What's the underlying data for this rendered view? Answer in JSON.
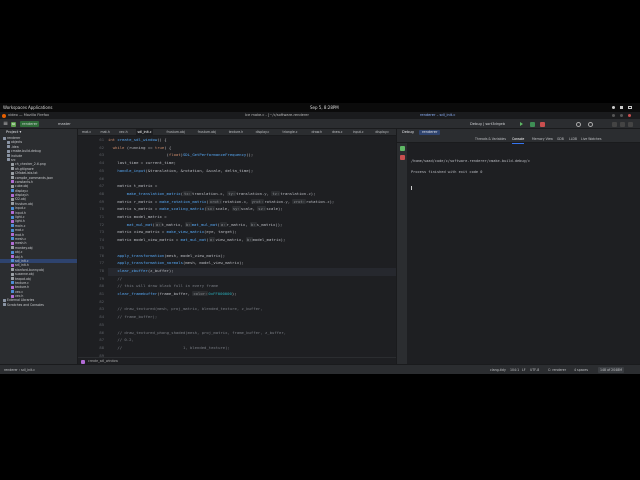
{
  "desktop": {
    "activities": "Workspaces",
    "applications": "Applications",
    "clock": "Sep 5, 8:28PM"
  },
  "window": {
    "title_left": "video — Mozilla Firefox",
    "title_center": "Ice make.c - [~/c/software-renderer",
    "title_right": "renderer – sdl_init.c"
  },
  "toolbar": {
    "project_badge": "SR",
    "project_name": "renderer",
    "branch": "master",
    "run_config": "Debug | sort3drgeb"
  },
  "project_panel": {
    "header": "Project",
    "tree": [
      {
        "label": "renderer",
        "depth": 0,
        "kind": "folder"
      },
      {
        "label": "objects",
        "depth": 1,
        "kind": "folder"
      },
      {
        "label": ".idea",
        "depth": 1,
        "kind": "folder"
      },
      {
        "label": "cmake-build-debug",
        "depth": 1,
        "kind": "folder"
      },
      {
        "label": "include",
        "depth": 1,
        "kind": "folder"
      },
      {
        "label": "src",
        "depth": 1,
        "kind": "folder"
      },
      {
        "label": "ch_checker_2.tl.png",
        "depth": 2,
        "kind": "file"
      },
      {
        "label": "ah.gitignore",
        "depth": 2,
        "kind": "file"
      },
      {
        "label": "CMakeLists.txt",
        "depth": 2,
        "kind": "file"
      },
      {
        "label": "compile_commands.json",
        "depth": 2,
        "kind": "file"
      },
      {
        "label": "constants.h",
        "depth": 2,
        "kind": "file"
      },
      {
        "label": "cube.obj",
        "depth": 2,
        "kind": "file"
      },
      {
        "label": "display.c",
        "depth": 2,
        "kind": "file"
      },
      {
        "label": "display.h",
        "depth": 2,
        "kind": "file"
      },
      {
        "label": "f22.obj",
        "depth": 2,
        "kind": "file"
      },
      {
        "label": "frustum.obj",
        "depth": 2,
        "kind": "file"
      },
      {
        "label": "input.c",
        "depth": 2,
        "kind": "file"
      },
      {
        "label": "input.h",
        "depth": 2,
        "kind": "file"
      },
      {
        "label": "light.c",
        "depth": 2,
        "kind": "file"
      },
      {
        "label": "light.h",
        "depth": 2,
        "kind": "file"
      },
      {
        "label": "main.c",
        "depth": 2,
        "kind": "file"
      },
      {
        "label": "mat.c",
        "depth": 2,
        "kind": "file"
      },
      {
        "label": "mat.h",
        "depth": 2,
        "kind": "file"
      },
      {
        "label": "mesh.c",
        "depth": 2,
        "kind": "file"
      },
      {
        "label": "mesh.h",
        "depth": 2,
        "kind": "file"
      },
      {
        "label": "monkey.obj",
        "depth": 2,
        "kind": "file"
      },
      {
        "label": "obj.c",
        "depth": 2,
        "kind": "file"
      },
      {
        "label": "obj.h",
        "depth": 2,
        "kind": "file"
      },
      {
        "label": "sdl_init.c",
        "depth": 2,
        "kind": "file",
        "selected": true
      },
      {
        "label": "sdl_init.h",
        "depth": 2,
        "kind": "file"
      },
      {
        "label": "stanford-bunny.obj",
        "depth": 2,
        "kind": "file"
      },
      {
        "label": "suzanne.obj",
        "depth": 2,
        "kind": "file"
      },
      {
        "label": "teapot.obj",
        "depth": 2,
        "kind": "file"
      },
      {
        "label": "texture.c",
        "depth": 2,
        "kind": "file"
      },
      {
        "label": "texture.h",
        "depth": 2,
        "kind": "file"
      },
      {
        "label": "vec.c",
        "depth": 2,
        "kind": "file"
      },
      {
        "label": "vec.h",
        "depth": 2,
        "kind": "file"
      },
      {
        "label": "External Libraries",
        "depth": 0,
        "kind": "folder"
      },
      {
        "label": "Scratches and Consoles",
        "depth": 0,
        "kind": "folder"
      }
    ]
  },
  "editor": {
    "tabs": [
      "mat.c",
      "mat.h",
      "vec.h",
      "sdl_init.c",
      "frustum.obj",
      "frustum.obj",
      "texture.h",
      "display.c",
      "triangle.c",
      "draw.h",
      "draw.c",
      "input.c",
      "display.c"
    ],
    "active_tab": 3,
    "line_numbers": [
      "61",
      "62",
      "63",
      "64",
      "65",
      "66",
      "67",
      "68",
      "69",
      "70",
      "71",
      "72",
      "73",
      "74",
      "75",
      "76",
      "77",
      "78",
      "79",
      "80",
      "81",
      "82",
      "83",
      "84",
      "85",
      "86",
      "87",
      "88",
      "89",
      "90"
    ],
    "breadcrumb": "create_sdl_window"
  },
  "debug_panel": {
    "title": "Debug",
    "config": "renderer",
    "tabs": [
      "Threads & Variables",
      "Console",
      "Memory View",
      "GDB",
      "LLDB",
      "Live Watches"
    ],
    "active_tab": 1,
    "console_lines": [
      "/home/saad/code/c/software-renderer/cmake-build-debug/c",
      "",
      "Process finished with exit code 0"
    ]
  },
  "status_bar": {
    "left": "renderer › sdl_init.c",
    "lint": "clang-tidy",
    "position": "104:1",
    "line_ending": "LF",
    "encoding": "UTF-8",
    "context": "C: renderer",
    "spaces": "4 spaces",
    "memory": "148 of 2048M"
  }
}
